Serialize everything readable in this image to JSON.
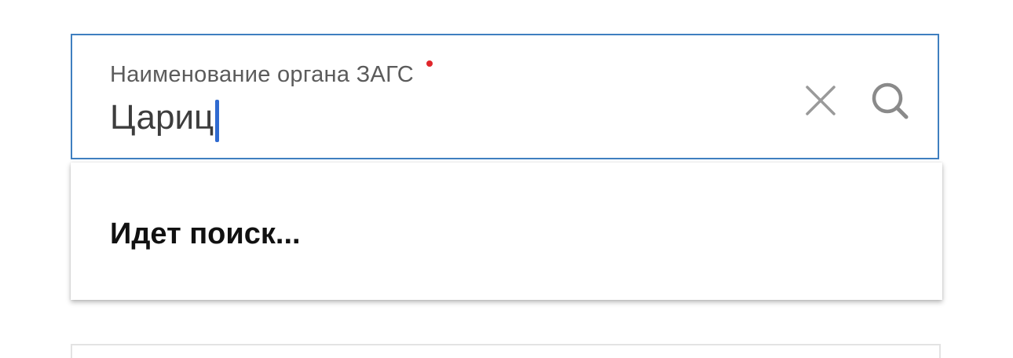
{
  "field": {
    "label": "Наименование органа ЗАГС",
    "required": true,
    "value": "Цариц",
    "accent_color": "#3f7fc0",
    "required_color": "#e0262b"
  },
  "icons": {
    "clear": "close-icon",
    "search": "search-icon"
  },
  "dropdown": {
    "status_text": "Идет поиск..."
  }
}
